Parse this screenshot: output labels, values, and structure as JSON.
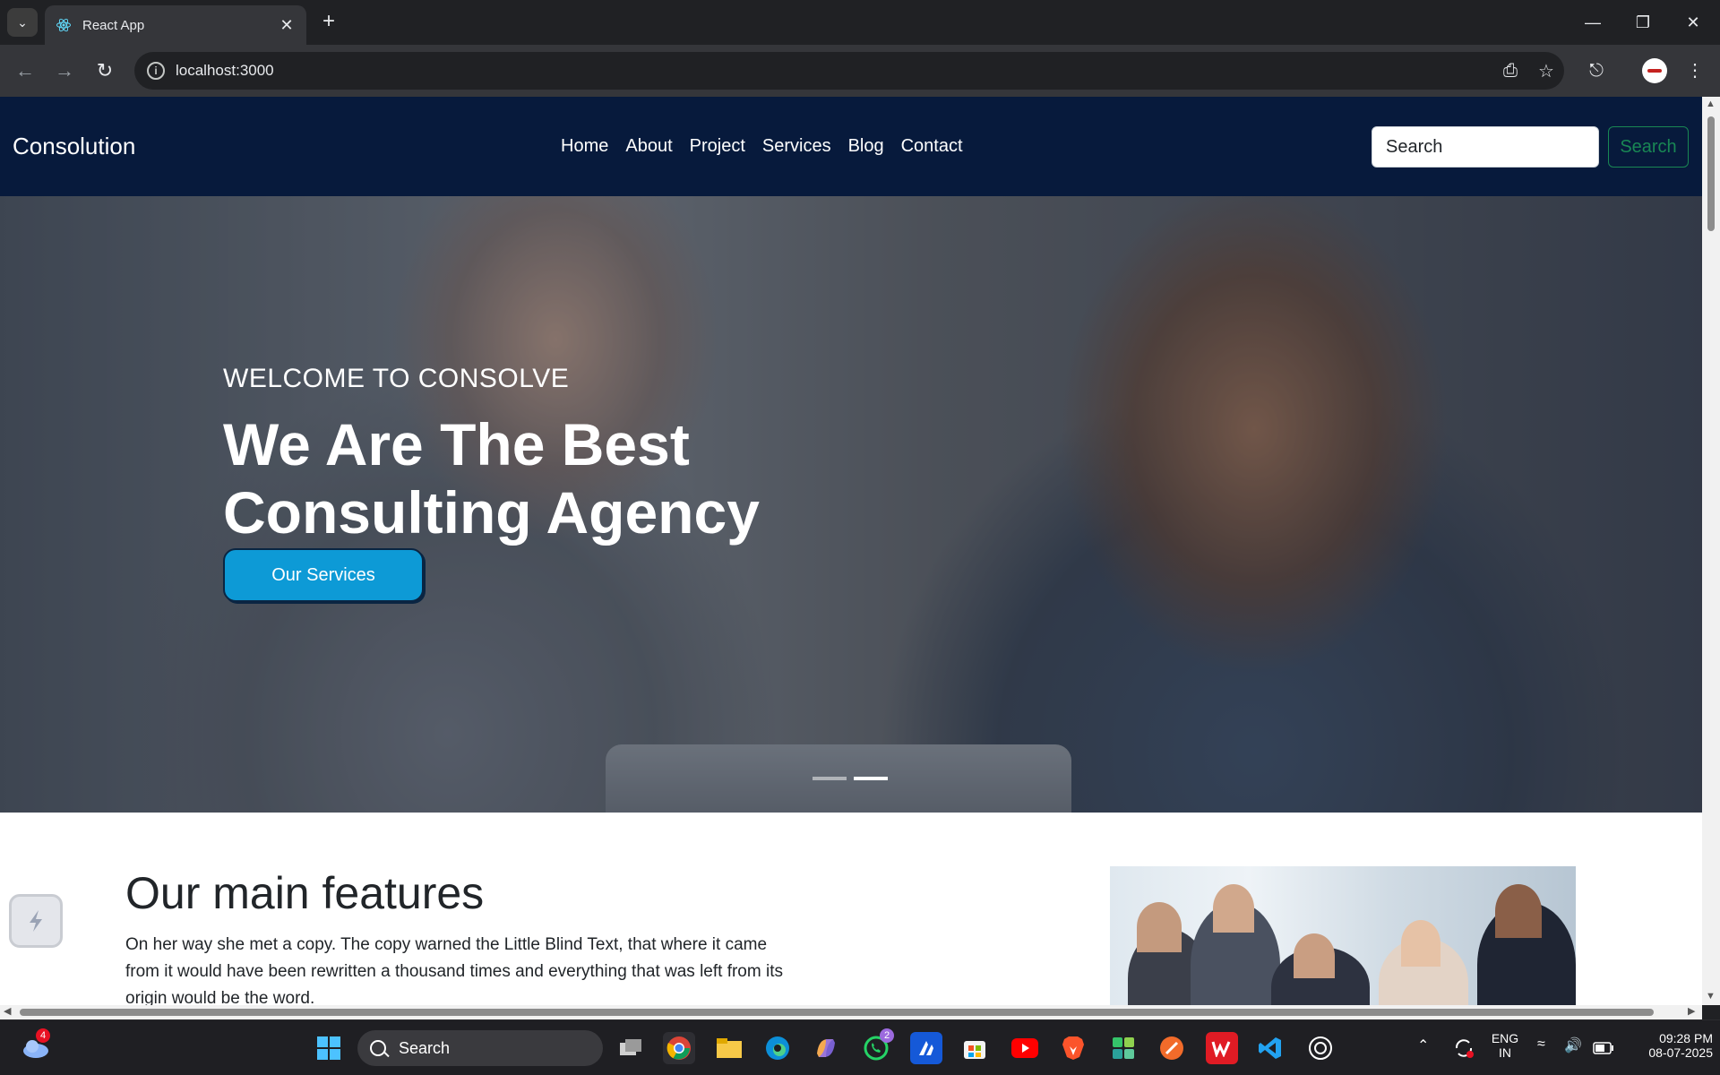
{
  "browser": {
    "tab_title": "React App",
    "url": "localhost:3000"
  },
  "site": {
    "brand": "Consolution",
    "nav": [
      "Home",
      "About",
      "Project",
      "Services",
      "Blog",
      "Contact"
    ],
    "search_placeholder": "Search",
    "search_button": "Search"
  },
  "hero": {
    "subtitle": "WELCOME TO CONSOLVE",
    "title": "We Are The Best Consulting Agency",
    "button": "Our Services"
  },
  "features": {
    "title": "Our main features",
    "text": "On her way she met a copy. The copy warned the Little Blind Text, that where it came from it would have been rewritten a thousand times and everything that was left from its origin would be the word."
  },
  "taskbar": {
    "search": "Search",
    "weather_badge": "4",
    "whatsapp_badge": "2",
    "lang": "ENG",
    "region": "IN",
    "time": "09:28 PM",
    "date": "08-07-2025"
  },
  "colors": {
    "navbar_bg": "#071a3c",
    "accent": "#0d9ad6",
    "search_btn": "#198754"
  }
}
